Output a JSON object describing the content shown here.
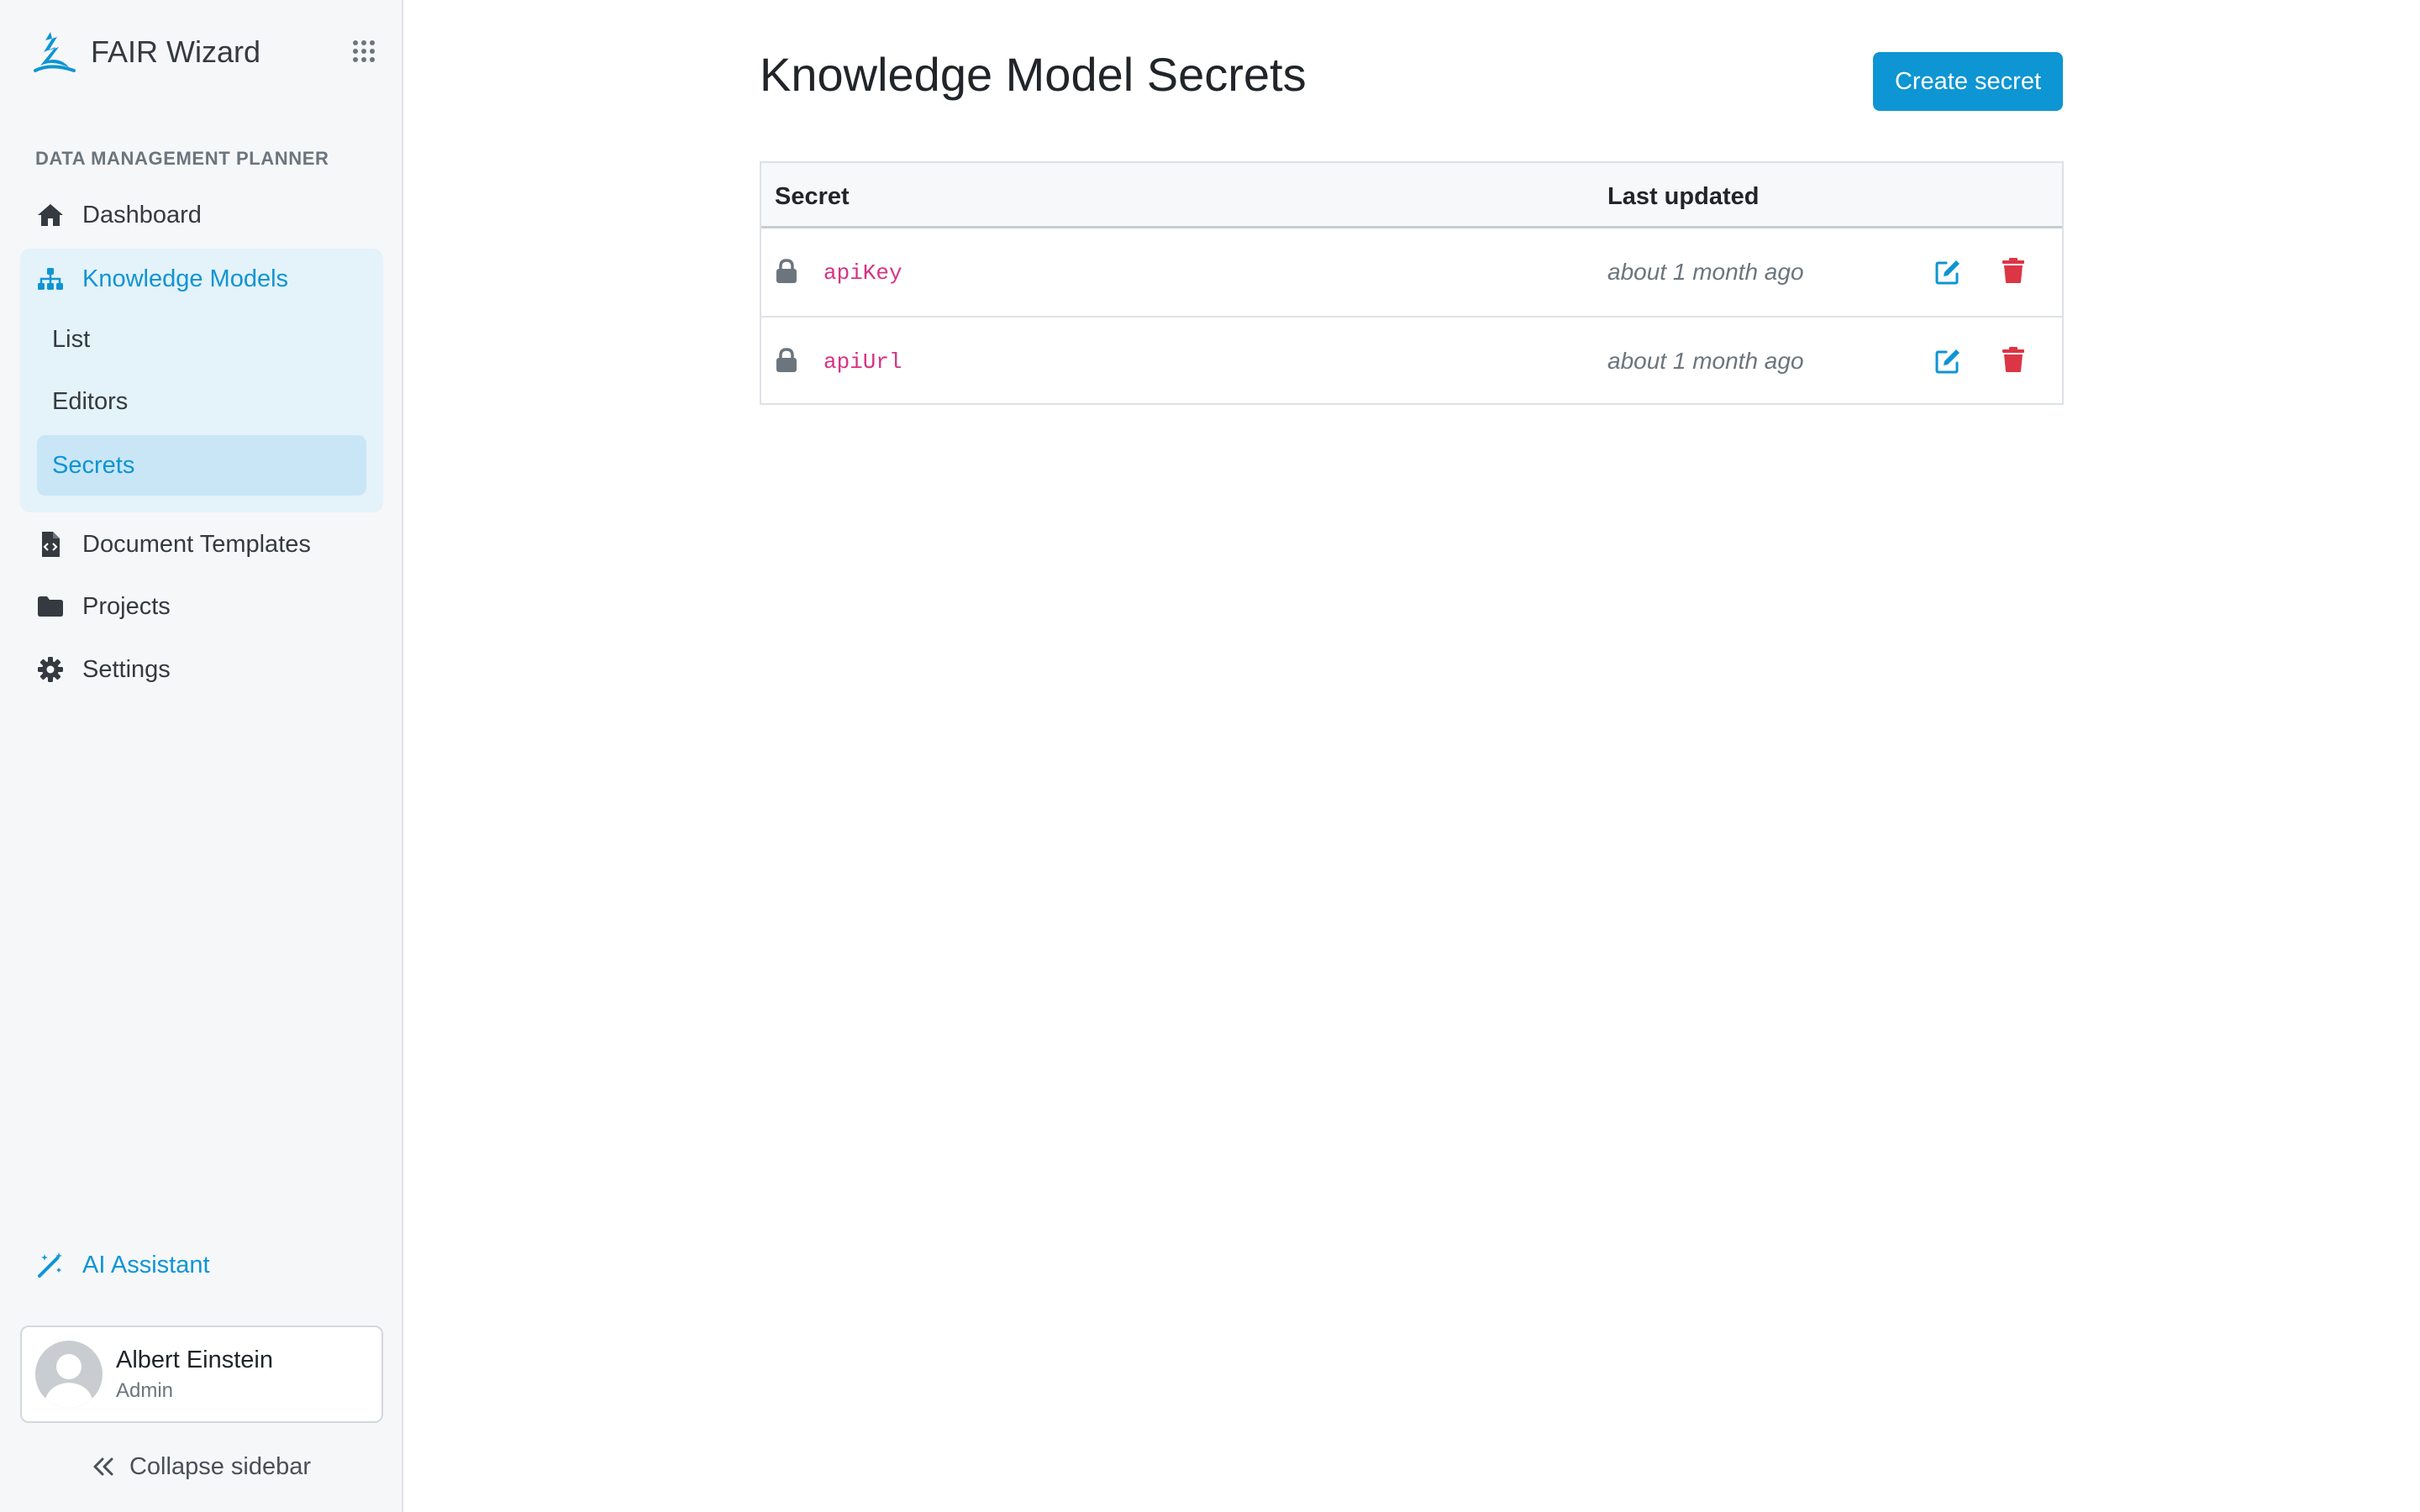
{
  "brand": {
    "name": "FAIR Wizard"
  },
  "sidebar": {
    "section_label": "DATA MANAGEMENT PLANNER",
    "nav": {
      "dashboard": "Dashboard",
      "knowledge_models": "Knowledge Models",
      "km_sub": {
        "list": "List",
        "editors": "Editors",
        "secrets": "Secrets"
      },
      "document_templates": "Document Templates",
      "projects": "Projects",
      "settings": "Settings"
    },
    "ai_assistant": "AI Assistant",
    "user": {
      "name": "Albert Einstein",
      "role": "Admin"
    },
    "collapse_label": "Collapse sidebar",
    "active_item": "Secrets"
  },
  "main": {
    "title": "Knowledge Model Secrets",
    "create_button": "Create secret",
    "table": {
      "headers": {
        "secret": "Secret",
        "last_updated": "Last updated"
      },
      "rows": [
        {
          "name": "apiKey",
          "updated": "about 1 month ago"
        },
        {
          "name": "apiUrl",
          "updated": "about 1 month ago"
        }
      ]
    }
  },
  "colors": {
    "accent": "#0e95d3",
    "code": "#d63384",
    "danger": "#dc3545",
    "sidebar_bg": "#f6f7f9",
    "active_group_bg": "#e4f2fa",
    "active_item_bg": "#c9e6f6"
  },
  "icons": {
    "brand": "fair-wizard-logo",
    "apps": "grid-icon",
    "dashboard": "home-icon",
    "knowledge_models": "sitemap-icon",
    "document_templates": "file-code-icon",
    "projects": "folder-icon",
    "settings": "gear-icon",
    "ai_assistant": "magic-wand-icon",
    "collapse": "double-chevron-left-icon",
    "secret": "lock-icon",
    "edit": "edit-icon",
    "delete": "trash-icon"
  }
}
